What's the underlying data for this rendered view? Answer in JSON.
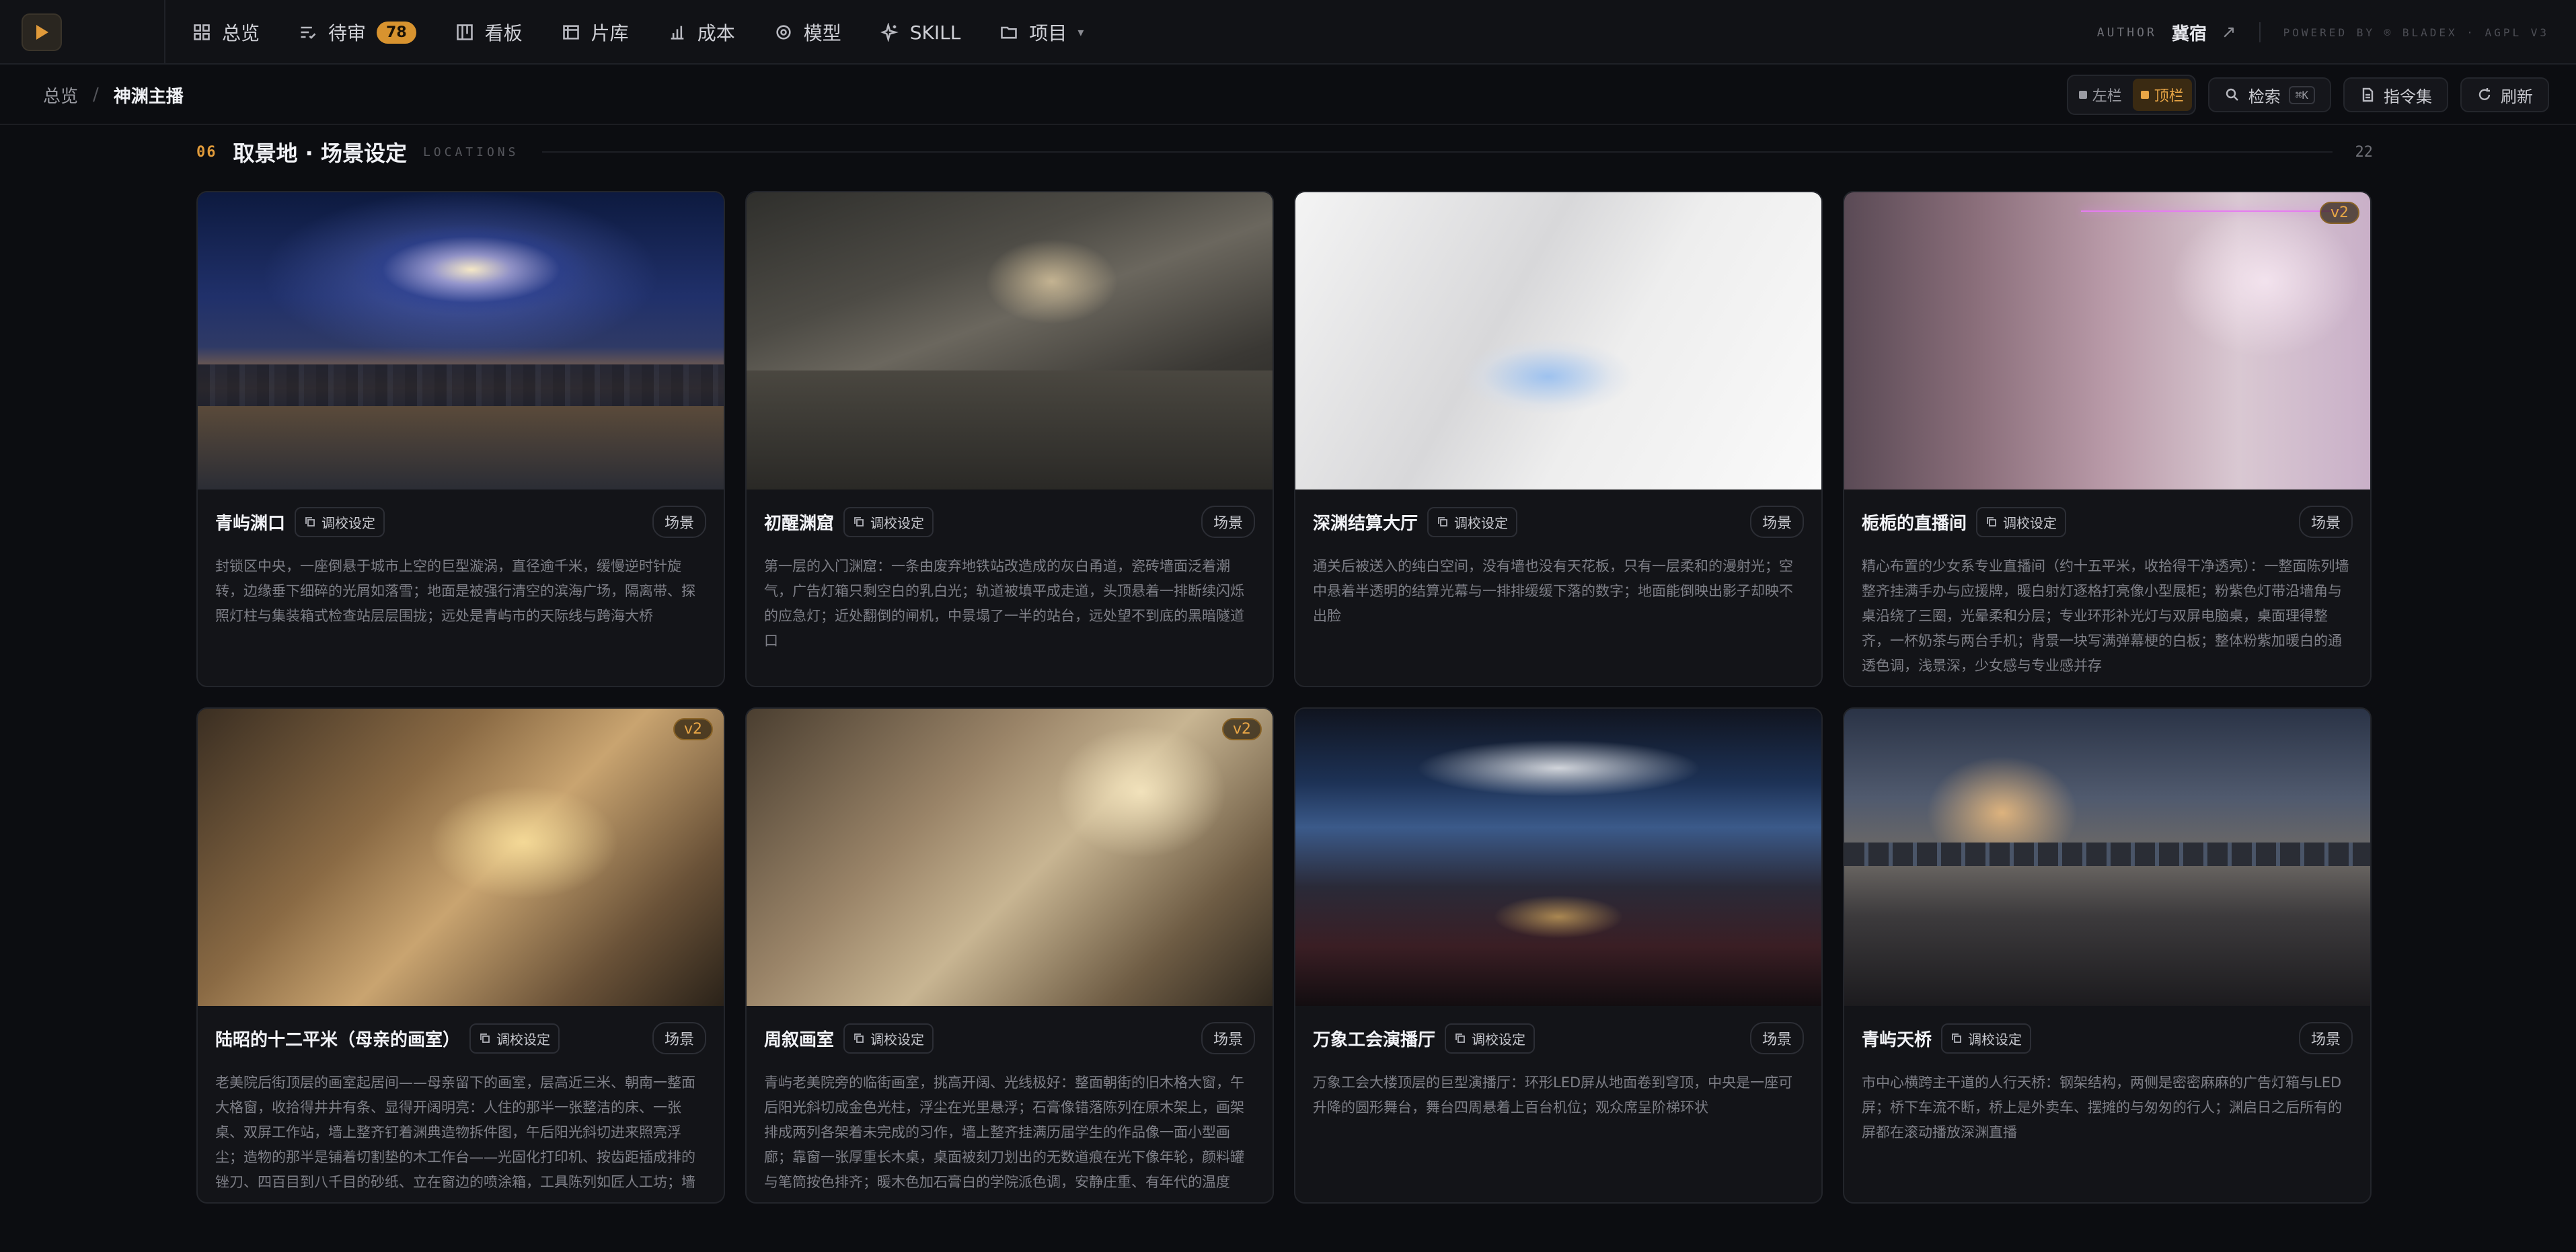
{
  "nav": {
    "items": [
      {
        "label": "总览",
        "icon": "grid-icon"
      },
      {
        "label": "待审",
        "icon": "list-check-icon",
        "badge": "78"
      },
      {
        "label": "看板",
        "icon": "kanban-icon"
      },
      {
        "label": "片库",
        "icon": "film-icon"
      },
      {
        "label": "成本",
        "icon": "bar-chart-icon"
      },
      {
        "label": "模型",
        "icon": "cube-icon"
      },
      {
        "label": "SKILL",
        "icon": "sparkle-icon"
      },
      {
        "label": "项目",
        "icon": "folder-icon"
      }
    ],
    "author_key": "AUTHOR",
    "author_name": "冀宿",
    "powered": "POWERED BY ® BLADEX · AGPL V3",
    "accent": "#d8932f"
  },
  "breadcrumb": {
    "root": "总览",
    "current": "神渊主播"
  },
  "toolbar": {
    "layout_left": "左栏",
    "layout_top": "顶栏",
    "search": "检索",
    "search_kbd": "⌘K",
    "commands": "指令集",
    "refresh": "刷新"
  },
  "section": {
    "num": "06",
    "title": "取景地 · 场景设定",
    "en": "LOCATIONS",
    "count": "22"
  },
  "tune_label": "调校设定",
  "cards": [
    {
      "title": "青屿渊口",
      "tag": "场景",
      "v2": "",
      "desc": "封锁区中央，一座倒悬于城市上空的巨型漩涡，直径逾千米，缓慢逆时针旋转，边缘垂下细碎的光屑如落雪；地面是被强行清空的滨海广场，隔离带、探照灯柱与集装箱式检查站层层围拢；远处是青屿市的天际线与跨海大桥"
    },
    {
      "title": "初醒渊窟",
      "tag": "场景",
      "v2": "",
      "desc": "第一层的入门渊窟：一条由废弃地铁站改造成的灰白甬道，瓷砖墙面泛着潮气，广告灯箱只剩空白的乳白光；轨道被填平成走道，头顶悬着一排断续闪烁的应急灯；近处翻倒的闸机，中景塌了一半的站台，远处望不到底的黑暗隧道口"
    },
    {
      "title": "深渊结算大厅",
      "tag": "场景",
      "v2": "",
      "desc": "通关后被送入的纯白空间，没有墙也没有天花板，只有一层柔和的漫射光；空中悬着半透明的结算光幕与一排排缓缓下落的数字；地面能倒映出影子却映不出脸"
    },
    {
      "title": "栀栀的直播间",
      "tag": "场景",
      "v2": "v2",
      "desc": "精心布置的少女系专业直播间（约十五平米，收拾得干净透亮）：一整面陈列墙整齐挂满手办与应援牌，暖白射灯逐格打亮像小型展柜；粉紫色灯带沿墙角与桌沿绕了三圈，光晕柔和分层；专业环形补光灯与双屏电脑桌，桌面理得整齐，一杯奶茶与两台手机；背景一块写满弹幕梗的白板；整体粉紫加暖白的通透色调，浅景深，少女感与专业感并存"
    },
    {
      "title": "陆昭的十二平米（母亲的画室）",
      "tag": "场景",
      "v2": "v2",
      "desc": "老美院后街顶层的画室起居间——母亲留下的画室，层高近三米、朝南一整面大格窗，收拾得井井有条、显得开阔明亮：人住的那半一张整洁的床、一张桌、双屏工作站，墙上整齐钉着渊典造物拆件图，午后阳光斜切进来照亮浮尘；造物的那半是铺着切割垫的木工作台——光固化打印机、按齿距插成排的锉刀、四百目到八千目的砂纸、立在窗边的喷涂箱，工具陈列如匠人工坊；墙上一整排原木搁板是这屋子真正贵的地方：照着那本书做出的三十七件手作，每一件都被窗光打亮；窗外是老城区的天际线；暖木色加米白的治愈色调，生活气息与匠气并存"
    },
    {
      "title": "周叙画室",
      "tag": "场景",
      "v2": "v2",
      "desc": "青屿老美院旁的临街画室，挑高开阔、光线极好：整面朝街的旧木格大窗，午后阳光斜切成金色光柱，浮尘在光里悬浮；石膏像错落陈列在原木架上，画架排成两列各架着未完成的习作，墙上整齐挂满历届学生的作品像一面小型画廊；靠窗一张厚重长木桌，桌面被刻刀划出的无数道痕在光下像年轮，颜料罐与笔筒按色排齐；暖木色加石膏白的学院派色调，安静庄重、有年代的温度"
    },
    {
      "title": "万象工会演播厅",
      "tag": "场景",
      "v2": "",
      "desc": "万象工会大楼顶层的巨型演播厅：环形LED屏从地面卷到穹顶，中央是一座可升降的圆形舞台，舞台四周悬着上百台机位；观众席呈阶梯环状"
    },
    {
      "title": "青屿天桥",
      "tag": "场景",
      "v2": "",
      "desc": "市中心横跨主干道的人行天桥：钢架结构，两侧是密密麻麻的广告灯箱与LED屏；桥下车流不断，桥上是外卖车、摆摊的与匆匆的行人；渊启日之后所有的屏都在滚动播放深渊直播"
    }
  ]
}
